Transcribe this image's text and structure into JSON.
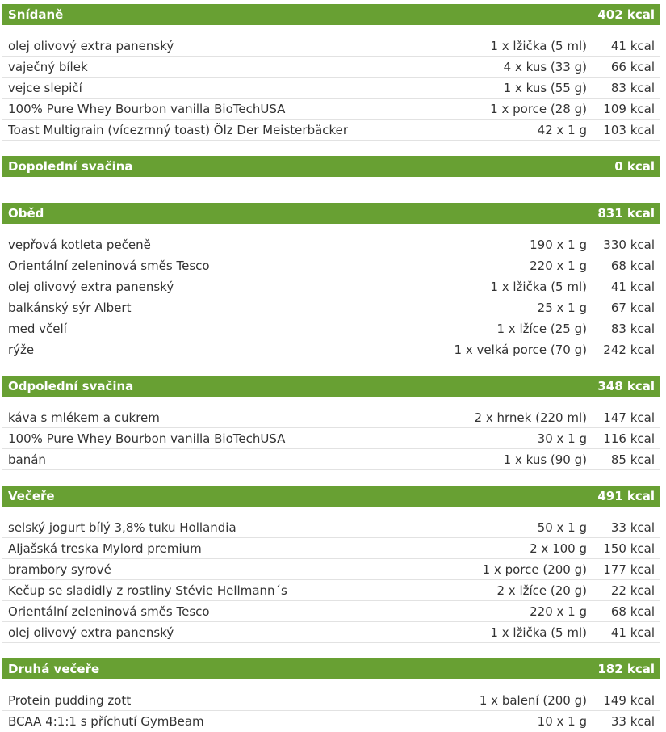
{
  "colors": {
    "accent": "#68a033",
    "text": "#333333",
    "divider": "#e2e2e2"
  },
  "meals": [
    {
      "title": "Snídaně",
      "total": "402 kcal",
      "items": [
        {
          "name": "olej olivový extra panenský",
          "amount": "1 x lžička (5 ml)",
          "kcal": "41 kcal"
        },
        {
          "name": "vaječný bílek",
          "amount": "4 x kus (33 g)",
          "kcal": "66 kcal"
        },
        {
          "name": "vejce slepičí",
          "amount": "1 x kus (55 g)",
          "kcal": "83 kcal"
        },
        {
          "name": "100% Pure Whey Bourbon vanilla BioTechUSA",
          "amount": "1 x porce (28 g)",
          "kcal": "109 kcal"
        },
        {
          "name": "Toast Multigrain (vícezrnný toast) Ölz Der Meisterbäcker",
          "amount": "42 x 1 g",
          "kcal": "103 kcal"
        }
      ]
    },
    {
      "title": "Dopolední svačina",
      "total": "0 kcal",
      "items": []
    },
    {
      "title": "Oběd",
      "total": "831 kcal",
      "items": [
        {
          "name": "vepřová kotleta pečeně",
          "amount": "190 x 1 g",
          "kcal": "330 kcal"
        },
        {
          "name": "Orientální zeleninová směs Tesco",
          "amount": "220 x 1 g",
          "kcal": "68 kcal"
        },
        {
          "name": "olej olivový extra panenský",
          "amount": "1 x lžička (5 ml)",
          "kcal": "41 kcal"
        },
        {
          "name": "balkánský sýr Albert",
          "amount": "25 x 1 g",
          "kcal": "67 kcal"
        },
        {
          "name": "med včelí",
          "amount": "1 x lžíce (25 g)",
          "kcal": "83 kcal"
        },
        {
          "name": "rýže",
          "amount": "1 x velká porce (70 g)",
          "kcal": "242 kcal"
        }
      ]
    },
    {
      "title": "Odpolední svačina",
      "total": "348 kcal",
      "items": [
        {
          "name": "káva s mlékem a cukrem",
          "amount": "2 x hrnek (220 ml)",
          "kcal": "147 kcal"
        },
        {
          "name": "100% Pure Whey Bourbon vanilla BioTechUSA",
          "amount": "30 x 1 g",
          "kcal": "116 kcal"
        },
        {
          "name": "banán",
          "amount": "1 x kus (90 g)",
          "kcal": "85 kcal"
        }
      ]
    },
    {
      "title": "Večeře",
      "total": "491 kcal",
      "items": [
        {
          "name": "selský jogurt bílý 3,8% tuku Hollandia",
          "amount": "50 x 1 g",
          "kcal": "33 kcal"
        },
        {
          "name": "Aljašská treska Mylord premium",
          "amount": "2 x 100 g",
          "kcal": "150 kcal"
        },
        {
          "name": "brambory syrové",
          "amount": "1 x porce (200 g)",
          "kcal": "177 kcal"
        },
        {
          "name": "Kečup se sladidly z rostliny Stévie Hellmann´s",
          "amount": "2 x lžíce (20 g)",
          "kcal": "22 kcal"
        },
        {
          "name": "Orientální zeleninová směs Tesco",
          "amount": "220 x 1 g",
          "kcal": "68 kcal"
        },
        {
          "name": "olej olivový extra panenský",
          "amount": "1 x lžička (5 ml)",
          "kcal": "41 kcal"
        }
      ]
    },
    {
      "title": "Druhá večeře",
      "total": "182 kcal",
      "items": [
        {
          "name": "Protein pudding zott",
          "amount": "1 x balení (200 g)",
          "kcal": "149 kcal"
        },
        {
          "name": "BCAA 4:1:1 s příchutí GymBeam",
          "amount": "10 x 1 g",
          "kcal": "33 kcal"
        }
      ]
    }
  ]
}
